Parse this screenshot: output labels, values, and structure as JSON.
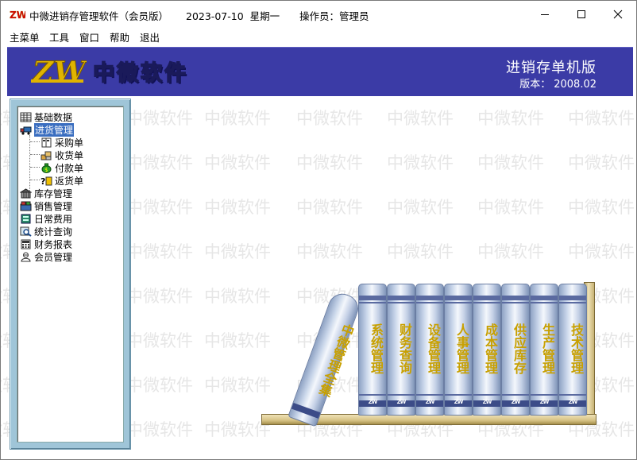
{
  "titlebar": {
    "app_title": "中微进销存管理软件（会员版）",
    "date": "2023-07-10",
    "weekday": "星期一",
    "operator": "操作员：管理员",
    "minimize": "—",
    "maximize": "☐",
    "close": "✕"
  },
  "menubar": {
    "items": [
      "主菜单",
      "工具",
      "窗口",
      "帮助",
      "退出"
    ]
  },
  "banner": {
    "logo_text": "ZW",
    "brand": "中微软件",
    "edition": "进销存单机版",
    "version_label": "版本：",
    "version": "2008.02"
  },
  "watermark": "中微软件",
  "nav": {
    "items": [
      {
        "label": "基础数据",
        "icon": "grid-icon"
      },
      {
        "label": "进货管理",
        "icon": "truck-icon",
        "selected": true
      },
      {
        "label": "采购单",
        "icon": "document-icon",
        "child": true
      },
      {
        "label": "收货单",
        "icon": "boxes-icon",
        "child": true
      },
      {
        "label": "付款单",
        "icon": "money-bag-icon",
        "child": true
      },
      {
        "label": "返货单",
        "icon": "return-icon",
        "child": true
      },
      {
        "label": "库存管理",
        "icon": "warehouse-icon"
      },
      {
        "label": "销售管理",
        "icon": "sales-icon"
      },
      {
        "label": "日常费用",
        "icon": "ledger-icon"
      },
      {
        "label": "统计查询",
        "icon": "magnifier-icon"
      },
      {
        "label": "财务报表",
        "icon": "calculator-icon"
      },
      {
        "label": "会员管理",
        "icon": "member-icon"
      }
    ]
  },
  "bookshelf": {
    "tilted_book": "中微管理全集",
    "books": [
      "系统管理",
      "财务查询",
      "设备管理",
      "人事管理",
      "成本管理",
      "供应库存",
      "生产管理",
      "技术管理"
    ],
    "spine_logo": "ZW"
  },
  "colors": {
    "banner": "#3b3ba6",
    "nav_frame": "#9fc5d8",
    "selection": "#3a6ec0",
    "book_title": "#c8a000"
  }
}
